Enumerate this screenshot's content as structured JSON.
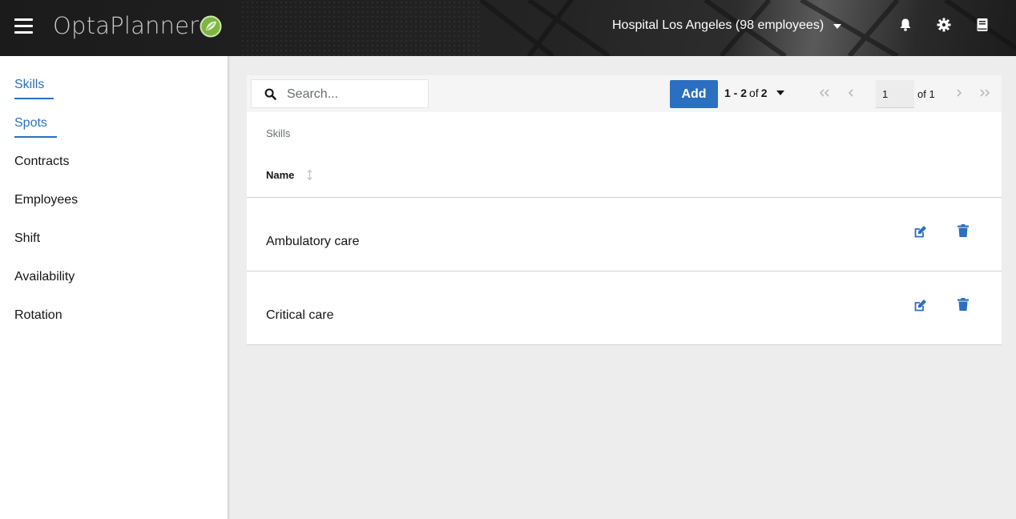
{
  "header": {
    "menu_icon": "hamburger-icon",
    "logo_text": "OptaPlanner",
    "tenant_label": "Hospital Los Angeles (98 employees)",
    "icons": [
      "bell-icon",
      "gear-icon",
      "book-icon"
    ]
  },
  "sidebar": {
    "items": [
      {
        "label": "Skills",
        "active": true
      },
      {
        "label": "Spots",
        "active": true
      },
      {
        "label": "Contracts",
        "active": false
      },
      {
        "label": "Employees",
        "active": false
      },
      {
        "label": "Shift",
        "active": false
      },
      {
        "label": "Availability",
        "active": false
      },
      {
        "label": "Rotation",
        "active": false
      }
    ]
  },
  "toolbar": {
    "search_placeholder": "Search...",
    "add_label": "Add",
    "range": "1 - 2",
    "of_word": "of",
    "total": "2",
    "current_page": "1",
    "page_total": "of 1"
  },
  "table": {
    "caption": "Skills",
    "column_name": "Name",
    "rows": [
      {
        "name": "Ambulatory care"
      },
      {
        "name": "Critical care"
      }
    ]
  },
  "colors": {
    "accent": "#2b6fc0",
    "header_bg": "#242424",
    "page_bg": "#ededed"
  }
}
